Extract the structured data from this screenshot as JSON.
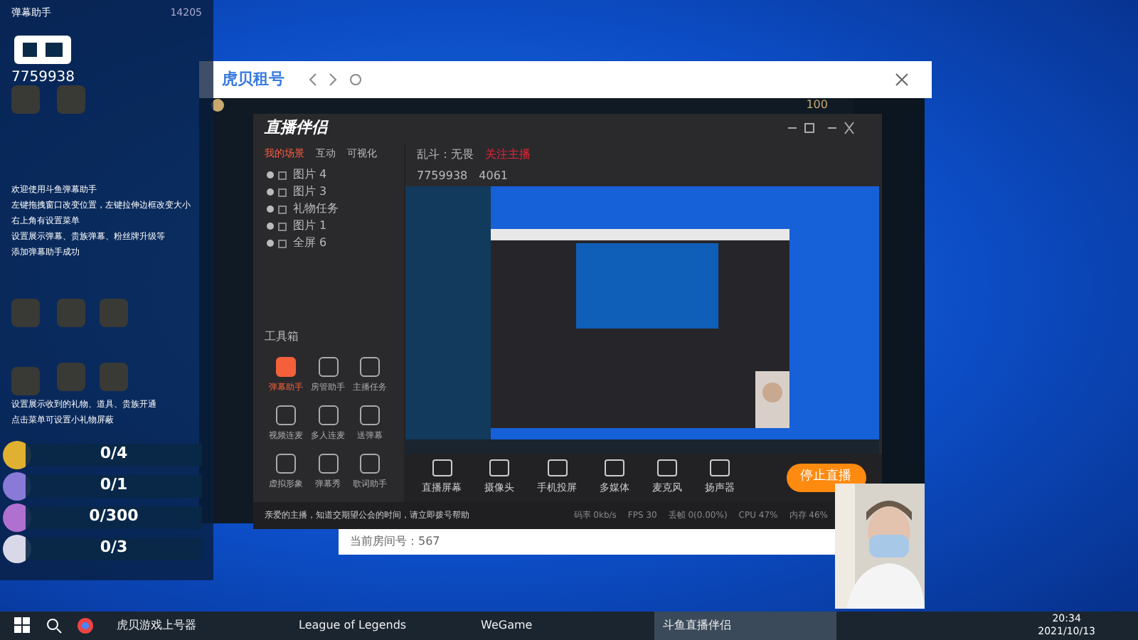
{
  "overlay": {
    "title": "弹幕助手",
    "fans": "14205",
    "room_id": "7759938",
    "messages": [
      "欢迎使用斗鱼弹幕助手",
      "左键拖拽窗口改变位置，左键拉伸边框改变大小",
      "右上角有设置菜单",
      "设置展示弹幕、贵族弹幕、粉丝牌升级等",
      "添加弹幕助手成功"
    ],
    "gift_hint": [
      "设置展示收到的礼物、道具、贵族开通",
      "点击菜单可设置小礼物屏蔽"
    ],
    "gifts": [
      {
        "count": "0/4",
        "color": "#e0b030"
      },
      {
        "count": "0/1",
        "color": "#8a7ad8"
      },
      {
        "count": "0/300",
        "color": "#b070d0"
      },
      {
        "count": "0/3",
        "color": "#d8d8e8"
      }
    ]
  },
  "browser_window": {
    "title": "虎贝租号"
  },
  "game_client": {
    "level": "100"
  },
  "studio": {
    "logo": "直播伴侣",
    "tabs": [
      {
        "label": "我的场景",
        "selected": true
      },
      {
        "label": "互动",
        "selected": false
      },
      {
        "label": "可视化",
        "selected": false
      }
    ],
    "scenes": [
      {
        "label": "图片 4"
      },
      {
        "label": "图片 3"
      },
      {
        "label": "礼物任务"
      },
      {
        "label": "图片 1"
      },
      {
        "label": "全屏 6"
      }
    ],
    "header": {
      "mode": "乱斗：无畏",
      "room": "7759938",
      "viewers": "4061",
      "warning": "关注主播"
    },
    "toolbox_title": "工具箱",
    "tools": [
      {
        "label": "弹幕助手",
        "active": true
      },
      {
        "label": "房管助手",
        "active": false
      },
      {
        "label": "主播任务",
        "active": false
      },
      {
        "label": "视频连麦",
        "active": false
      },
      {
        "label": "多人连麦",
        "active": false
      },
      {
        "label": "送弹幕",
        "active": false
      },
      {
        "label": "虚拟形象",
        "active": false
      },
      {
        "label": "弹幕秀",
        "active": false
      },
      {
        "label": "歌词助手",
        "active": false
      }
    ],
    "controls": [
      {
        "label": "直播屏幕"
      },
      {
        "label": "摄像头"
      },
      {
        "label": "手机投屏"
      },
      {
        "label": "多媒体"
      },
      {
        "label": "麦克风"
      },
      {
        "label": "扬声器"
      }
    ],
    "stop_button": "停止直播",
    "notice": "亲爱的主播，知道交期望公会的时间，请立即拨号帮助",
    "stats": [
      "码率 0kb/s",
      "FPS 30",
      "丢帧 0(0.00%)",
      "CPU 47%",
      "内存 46%"
    ]
  },
  "room_bar": {
    "text": "当前房间号：567"
  },
  "taskbar": {
    "apps": [
      {
        "label": "虎贝游戏上号器",
        "selected": false
      },
      {
        "label": "League of Legends",
        "selected": false
      },
      {
        "label": "WeGame",
        "selected": false
      },
      {
        "label": "斗鱼直播伴侣",
        "selected": true
      }
    ],
    "time": "20:34",
    "date": "2021/10/13"
  }
}
